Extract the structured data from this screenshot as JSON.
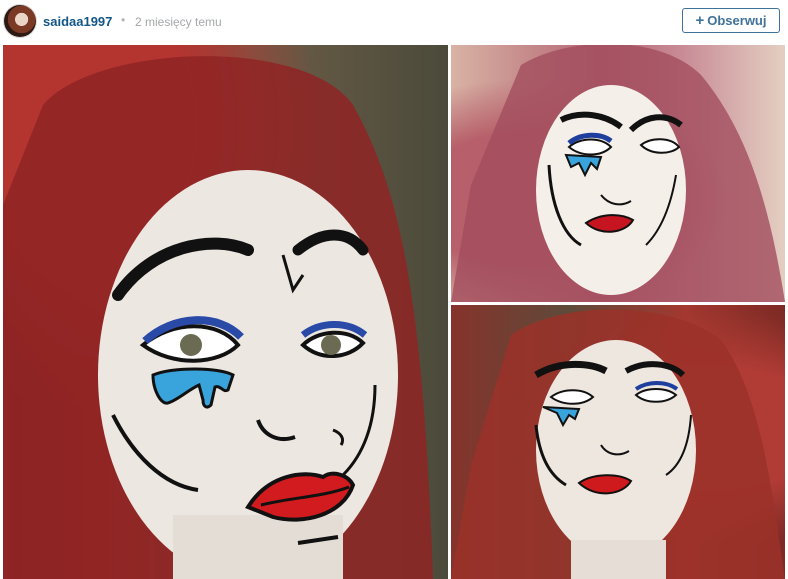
{
  "post": {
    "username": "saidaa1997",
    "separator": "•",
    "time_ago": "2 miesięcy temu",
    "follow_plus": "+",
    "follow_label": "Obserwuj"
  },
  "photos": [
    {
      "name": "pop-art-makeup-closeup",
      "colors": {
        "skin": "#ece7e1",
        "lips": "#d11b1e",
        "tear": "#39a4dc"
      }
    },
    {
      "name": "pop-art-makeup-portrait-top",
      "colors": {
        "skin": "#f5efe9",
        "lips": "#c61420"
      }
    },
    {
      "name": "pop-art-makeup-portrait-bottom",
      "colors": {
        "skin": "#eee7e0",
        "lips": "#cf1a1d"
      }
    }
  ]
}
